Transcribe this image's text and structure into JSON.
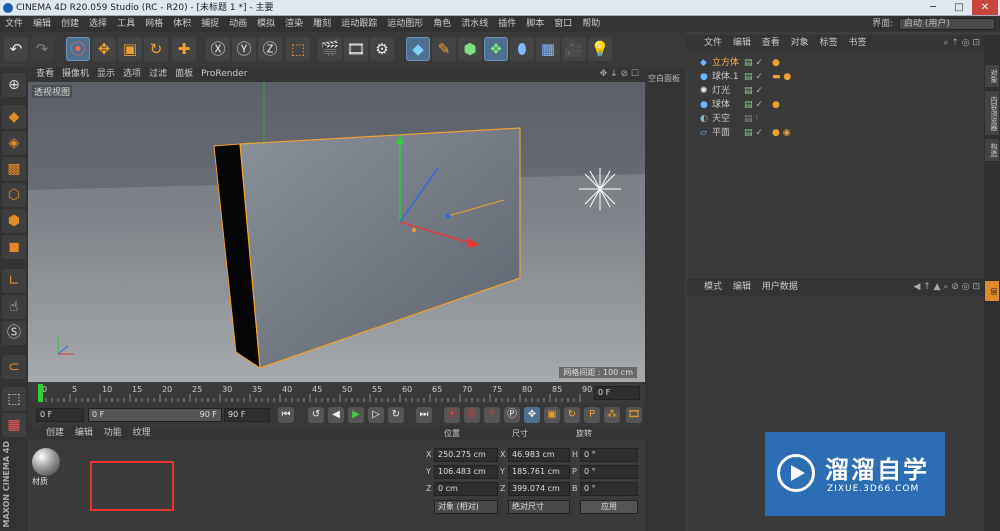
{
  "title": "CINEMA 4D R20.059 Studio (RC - R20) - [未标题 1 *] - 主要",
  "window_controls": {
    "min": "─",
    "max": "□",
    "close": "✕"
  },
  "menu": [
    "文件",
    "编辑",
    "创建",
    "选择",
    "工具",
    "网格",
    "体积",
    "捕捉",
    "动画",
    "模拟",
    "渲染",
    "雕刻",
    "运动跟踪",
    "运动图形",
    "角色",
    "流水线",
    "插件",
    "脚本",
    "窗口",
    "帮助"
  ],
  "interface_label": "界面:",
  "interface_value": "启动 (用户)",
  "viewport": {
    "menu": [
      "查看",
      "摄像机",
      "显示",
      "选项",
      "过滤",
      "面板",
      "ProRender"
    ],
    "name": "透视视图",
    "grid_label": "网格间距 : 100 cm",
    "nav_icons": "✥ ↓ ⊘ ☐"
  },
  "right_tab_label": "空白面板",
  "timeline": {
    "ticks": [
      "0",
      "5",
      "10",
      "15",
      "20",
      "25",
      "30",
      "35",
      "40",
      "45",
      "50",
      "55",
      "60",
      "65",
      "70",
      "75",
      "80",
      "85",
      "90"
    ],
    "frame_end_field": "0 F",
    "current": "0 F",
    "range_start": "0 F",
    "range_end": "90 F",
    "max": "90 F"
  },
  "materials": {
    "menu": [
      "创建",
      "编辑",
      "功能",
      "纹理"
    ],
    "items": [
      {
        "name": "材质"
      }
    ]
  },
  "coords": {
    "headers": [
      "位置",
      "尺寸",
      "旋转"
    ],
    "rows": [
      {
        "a": "X",
        "pos": "250.275 cm",
        "b": "X",
        "size": "46.983 cm",
        "c": "H",
        "rot": "0 °"
      },
      {
        "a": "Y",
        "pos": "106.483 cm",
        "b": "Y",
        "size": "185.761 cm",
        "c": "P",
        "rot": "0 °"
      },
      {
        "a": "Z",
        "pos": "0 cm",
        "b": "Z",
        "size": "399.074 cm",
        "c": "B",
        "rot": "0 °"
      }
    ],
    "mode1": "对象 (相对)",
    "mode2": "绝对尺寸",
    "apply": "应用"
  },
  "object_manager": {
    "menu": [
      "文件",
      "编辑",
      "查看",
      "对象",
      "标签",
      "书签"
    ],
    "objects": [
      {
        "name": "立方体",
        "selected": true
      },
      {
        "name": "球体.1",
        "selected": false
      },
      {
        "name": "灯光",
        "selected": false
      },
      {
        "name": "球体",
        "selected": false
      },
      {
        "name": "天空",
        "selected": false
      },
      {
        "name": "平面",
        "selected": false
      }
    ]
  },
  "attribute_manager": {
    "menu": [
      "模式",
      "编辑",
      "用户数据"
    ]
  },
  "side_tabs": [
    "对象",
    "内容浏览器",
    "构造",
    "层"
  ],
  "maxon": "MAXON CINEMA 4D",
  "watermark": {
    "title": "溜溜自学",
    "url": "ZIXUE.3D66.COM"
  },
  "colors": {
    "accent": "#f0a030",
    "selection": "#ffb040",
    "watermark_bg": "#2d6db3"
  }
}
